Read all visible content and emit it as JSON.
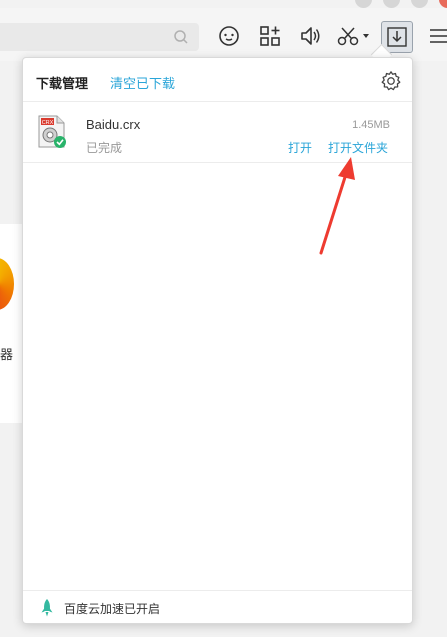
{
  "panel": {
    "title": "下载管理",
    "clear_label": "清空已下载",
    "settings_icon": "gear-icon"
  },
  "downloads": [
    {
      "filename": "Baidu.crx",
      "size": "1.45MB",
      "status": "已完成",
      "open_label": "打开",
      "open_folder_label": "打开文件夹",
      "file_icon_text": "CRX"
    }
  ],
  "footer": {
    "text": "百度云加速已开启",
    "icon": "rocket-icon"
  },
  "background": {
    "partial_text": "器"
  },
  "colors": {
    "accent": "#2aa5d8",
    "annotation_arrow": "#ee3b30",
    "complete_badge": "#29b36a"
  }
}
